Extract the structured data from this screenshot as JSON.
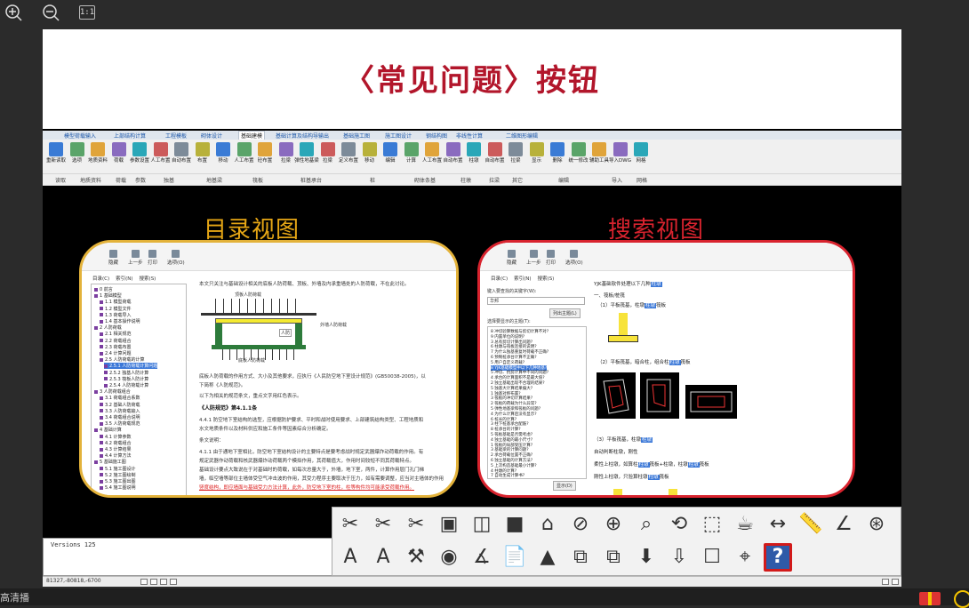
{
  "viewer": {
    "zoom_in_icon": "zoom-in-icon",
    "zoom_out_icon": "zoom-out-icon",
    "actual_size_label": "1:1",
    "bottom_left_text": "高清播"
  },
  "slide": {
    "title": "〈常见问题〉按钮",
    "title_color": "#b2162b",
    "directory_view_label": "目录视图",
    "search_view_label": "搜索视图",
    "directory_color": "#e6a615",
    "search_color": "#d8232e"
  },
  "ribbon": {
    "tabs": [
      "模型荷载输入",
      "上部结构计算",
      "工程模板",
      "砌体设计",
      "基础建模",
      "基础计算及结构导输出",
      "基础施工图",
      "施工图设计",
      "钢结构图",
      "非线性计算",
      "二维图形编辑"
    ],
    "active_tab": "基础建模",
    "buttons": [
      "重新读取",
      "选项",
      "地质资料",
      "荷载",
      "参数设置",
      "人工布置",
      "自动布置",
      "布置",
      "移动",
      "人工布置",
      "砼布置",
      "拉梁",
      "弹性地基梁",
      "拉梁",
      "定义布置",
      "移动",
      "编辑",
      "计算",
      "人工布置",
      "自动布置",
      "柱墩",
      "自动布置",
      "拉梁",
      "显示",
      "删除",
      "统一修改",
      "辅助工具",
      "导入DWG",
      "网格"
    ],
    "groups": [
      "读取",
      "地质资料",
      "荷载",
      "参数",
      "独基",
      "地基梁",
      "筏板",
      "桩基承台",
      "桩",
      "砌体条基",
      "柱墩",
      "拉梁",
      "其它",
      "编辑",
      "导入",
      "网格"
    ]
  },
  "directory_panel": {
    "toolbar": [
      "隐藏",
      "上一步",
      "打印",
      "选项(O)"
    ],
    "tabs": [
      "目录(C)",
      "索引(N)",
      "搜索(S)"
    ],
    "tree": [
      "0 前言",
      "1 基础模型",
      "1.1 模型荷载",
      "1.2 模型文件",
      "1.3 荷载导入",
      "1.4 基本操作说明",
      "2 人防荷载",
      "2.1 相关规范",
      "2.2 荷载组合",
      "2.3 荷载布置",
      "2.4 计算问题",
      "2.5 人防荷载的计算",
      "2.5.1 人防荷载计算问题",
      "2.5.2 独基人防计算",
      "2.5.3 筏板人防计算",
      "2.5.4 人防荷载计算",
      "3 人防荷载组合",
      "3.1 荷载组合系数",
      "3.2 基础人防荷载",
      "3.3 人防荷载输入",
      "3.4 荷载组合说明",
      "3.5 人防荷载规范",
      "4 基础计算",
      "4.1 计算参数",
      "4.2 荷载组合",
      "4.3 计算结果",
      "4.4 计算方法",
      "5 基础施工图",
      "5.1 施工图设计",
      "5.2 施工图绘制",
      "5.3 施工图出图",
      "5.4 施工图说明"
    ],
    "selected_tree_index": 12,
    "doc_intro": "本文只关注与基础设计相关的底板人防荷载、顶板、外墙及内承重墙处的人防荷载，不在此讨论。",
    "diagram_labels": {
      "top": "顶板人防荷载",
      "side": "外墙人防荷载",
      "room": "人防",
      "bottom": "底板人防荷载"
    },
    "doc_para1": "底板人防荷载的作用方式、大小及其他要求，应执行《人民防空地下室设计规范》(GB50038-2005)，以",
    "doc_para2": "下简称《人防规范》。",
    "doc_para3": "以下为相关的规范条文，重点文字用红色表示。",
    "doc_heading": "《人防规范》第4.1.1条",
    "doc_para4": "4.4.1 防空地下室结构的选型，应根据防护要求、平时和战时使用要求、上部建筑结构类型、工程地质和",
    "doc_para5": "水文地质条件以及材料供应和施工条件等因素综合分析确定。",
    "doc_para6": "条文说明：",
    "doc_para7": "4.1.1 由于通地下室相比，防空地下室结构设计的主要特点是要考虑战时规定武器爆炸动荷载的作用。有",
    "doc_para8": "规定武器作动荷载和核武器爆炸动荷载两个模拟作用，其荷载值大，作用时间较短不同其荷载特点。",
    "doc_para9": "基础设计要点大致说在于对基础时的荷载，如每次总量大于，外墙，地下室，两件，计算作用层门孔门梯",
    "doc_para10": "墙，临空墙等部位主墙体受空气冲击波的作用，其受力程序主要取决于压力，如有需要调整，应当对主墙体的作用",
    "doc_para11": "竖度结构，即应墙面与基础受力方法计算，此外，防空地下室的柱，柱等构件均可能承受荷载作用。"
  },
  "search_panel": {
    "toolbar": [
      "隐藏",
      "上一步",
      "打印",
      "选项(O)"
    ],
    "tabs": [
      "目录(C)",
      "索引(N)",
      "搜索(S)"
    ],
    "search_label": "键入要查找的关键字(W):",
    "search_value": "华邦",
    "list_topics_button": "列出主题(L)",
    "topics_label": "选择要显示的主题(T):",
    "results": [
      "8 冲切验算数据与剪切计算不对?",
      "9 内置单位的说明?",
      "3 总有剪切计算出问题?",
      "6 柱墩与筏板连接的说明?",
      "7 为什么独基重复时荷载不正确?",
      "6 预制桩承台计算不正确?",
      "5 用户自定义荷载?",
      "8 YJK基础模型中以下几种地基?",
      "5 冲切、抗剪计算中不同的问题?",
      "4 承台的计算面积不是最大值?",
      "2 独立基础出现不合理的结果?",
      "5 独基大计算结果偏大?",
      "1 独基对称布置?",
      "3 筏板的冲切计算结果?",
      "2 筏板的荷载为什么异常?",
      "5 弹性地基梁和筏板的问题?",
      "4 为什么计算后没有显示?",
      "6 桩长的计算?",
      "3 柱下桩基承台配筋?",
      "8 桩承台的计算?",
      "5 筏板基础是否需考虑?",
      "4 独立基础的最小尺寸?",
      "1 筏板的局部受压计算?",
      "3 基础梁的计算问题?",
      "2 承台荷载位置不正确?",
      "6 独立基础的计算方法?",
      "5 上次构造基础最小计算?",
      "4 柱墩的计算?",
      "7 自动生成计算书?"
    ],
    "selected_result_index": 7,
    "show_button": "显示(D)",
    "doc_line1_pre": "YJK基础软件处理以下几种",
    "doc_line1_hl": "柱墩",
    "doc_line2": "一、筏板/桩筏",
    "doc_line3_pre": "（1）平板筏基，柱墩",
    "doc_line3_hl": "柱墩",
    "doc_line3_post": "筏板",
    "doc_line4_pre": "（2）平板筏基，暗合柱，组合柱",
    "doc_line4_hl": "柱墩",
    "doc_line4_post": "筏板",
    "doc_line5_pre": "（3）平板筏基，柱墩",
    "doc_line5_hl": "柱墩",
    "doc_line6": "自动判断柱墩，刚性",
    "doc_line7_pre": "柔性上柱墩，如算柱",
    "doc_line7_hl": "柱墩",
    "doc_line7_mid": "筏板+柱墩，柱墩",
    "doc_line7_hl2": "柱墩",
    "doc_line7_post": "筏板",
    "doc_line8_pre": "刚性上柱墩，只验算柱墩",
    "doc_line8_hl": "柱墩",
    "doc_line8_post": "筏板"
  },
  "command": {
    "text": "Versions  125",
    "coords": "81327,-80818,-6700"
  },
  "icon_toolbar": {
    "row1": [
      "trim-icon",
      "extend-icon",
      "break-icon",
      "box-3d-icon",
      "wireframe-3d-icon",
      "solid-3d-icon",
      "house-3d-icon",
      "orbit-icon",
      "zoom-window-icon",
      "zoom-in-icon",
      "zoom-realtime-icon",
      "selection-window-icon",
      "teapot-icon",
      "dimension-linear-icon",
      "measure-ruler-icon",
      "dimension-angle-icon",
      "dimension-radius-icon"
    ],
    "row2": [
      "text-erase-icon",
      "text-style-icon",
      "wrench-icon",
      "screenshot-icon",
      "angle-measure-icon",
      "pdf-export-icon",
      "cad-export-icon",
      "copy-layout-icon",
      "paste-layout-icon",
      "block-insert-icon",
      "import-icon",
      "highlight-icon",
      "binoculars-icon",
      "help-faq-icon"
    ],
    "help_label": "?",
    "help_accent": "#d21a1a"
  }
}
